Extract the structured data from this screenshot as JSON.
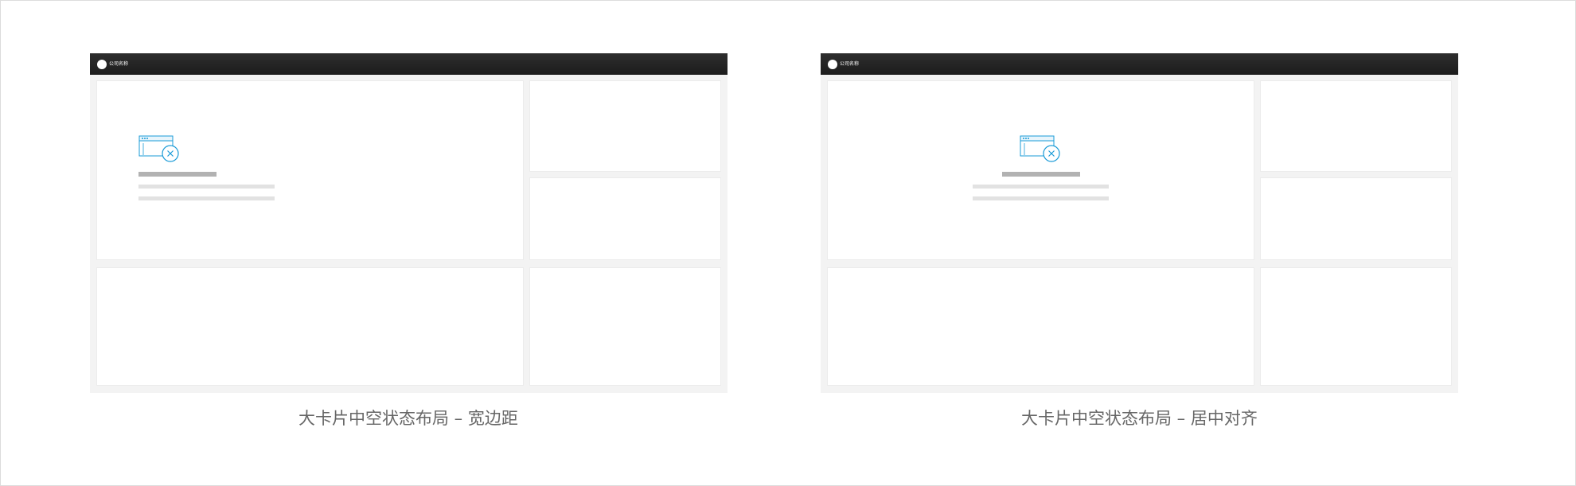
{
  "panels": [
    {
      "company_name": "公司名称",
      "caption": "大卡片中空状态布局 – 宽边距",
      "empty_state_alignment": "left"
    },
    {
      "company_name": "公司名称",
      "caption": "大卡片中空状态布局 – 居中对齐",
      "empty_state_alignment": "center"
    }
  ],
  "colors": {
    "topbar": "#222222",
    "canvas": "#f3f3f3",
    "card": "#ffffff",
    "icon_accent": "#1a9bd7",
    "title_placeholder": "#b2b2b2",
    "line_placeholder": "#e2e2e2",
    "caption": "#666666"
  },
  "icons": {
    "logo": "circle-logo-icon",
    "empty_state": "window-error-icon"
  }
}
